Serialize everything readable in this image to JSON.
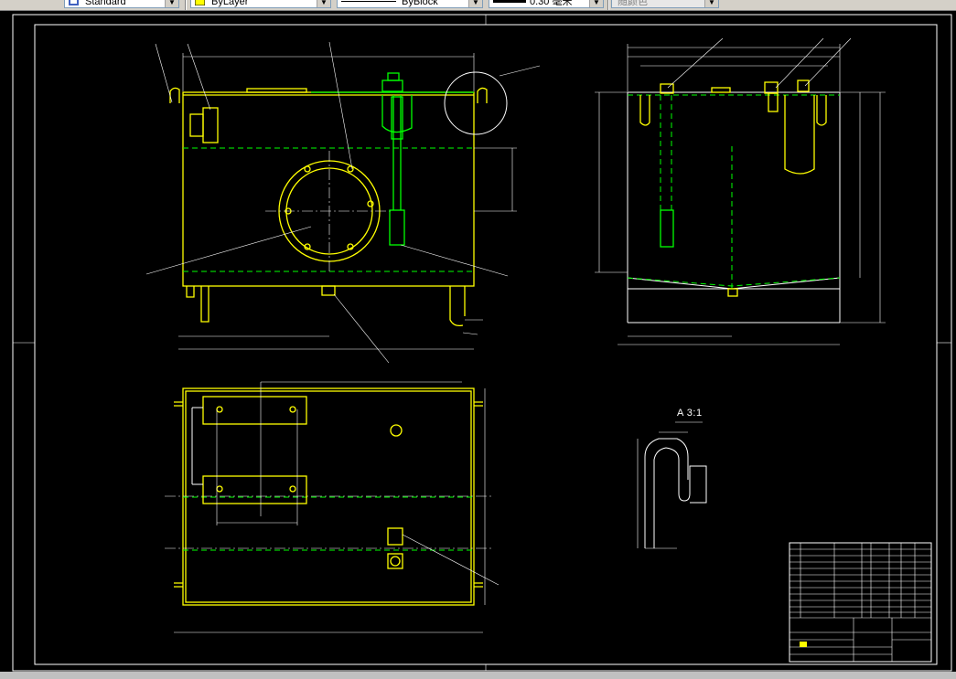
{
  "toolbar": {
    "text_style": "Standard",
    "layer": "ByLayer",
    "linetype": "ByBlock",
    "lineweight": "0.30 毫米",
    "plot_style": "随颜色",
    "layer_color": "#ffff00"
  },
  "drawing": {
    "detail_label": "A  3:1",
    "colors": {
      "frame": "#ffffff",
      "outline": "#ffff00",
      "hidden": "#00ff00",
      "center": "#ffffff",
      "leader": "#ffffff"
    }
  }
}
